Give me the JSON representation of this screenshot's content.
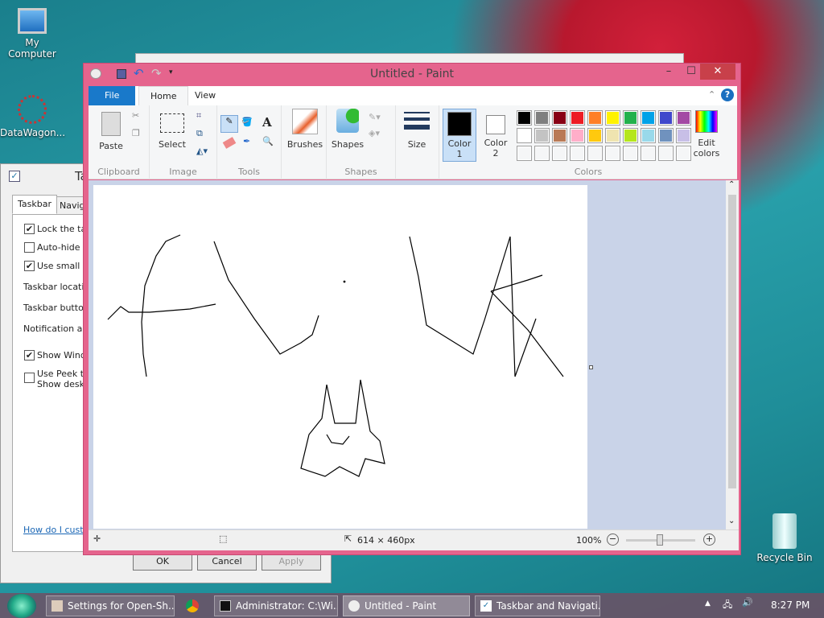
{
  "desktop": {
    "icons": [
      {
        "label": "My Computer",
        "icon": "computer-icon"
      },
      {
        "label": "DataWagon...",
        "icon": "shortcut-icon"
      },
      {
        "label": "Recycle Bin",
        "icon": "recycle-bin-icon"
      }
    ]
  },
  "dialog": {
    "title": "Ta",
    "tabs": [
      "Taskbar",
      "Naviga"
    ],
    "checks": [
      {
        "label": "Lock the tas",
        "checked": true
      },
      {
        "label": "Auto-hide th",
        "checked": false
      },
      {
        "label": "Use small ta",
        "checked": true
      }
    ],
    "labels": [
      "Taskbar locatio",
      "Taskbar button",
      "Notification are"
    ],
    "check2": [
      {
        "label": "Show Windo",
        "checked": true
      },
      {
        "label": "Use Peek to\nShow deskto",
        "checked": false
      }
    ],
    "help_link": "How do I custo",
    "buttons": {
      "ok": "OK",
      "cancel": "Cancel",
      "apply": "Apply"
    }
  },
  "paint": {
    "title": "Untitled - Paint",
    "tabs": {
      "file": "File",
      "home": "Home",
      "view": "View"
    },
    "groups": {
      "clipboard": "Clipboard",
      "image": "Image",
      "tools": "Tools",
      "shapes": "Shapes",
      "colors": "Colors"
    },
    "buttons": {
      "paste": "Paste",
      "select": "Select",
      "brushes": "Brushes",
      "shapes": "Shapes",
      "size": "Size",
      "color1": "Color\n1",
      "color2": "Color\n2",
      "edit_colors": "Edit\ncolors"
    },
    "palette": [
      [
        "#000000",
        "#7f7f7f",
        "#880015",
        "#ed1c24",
        "#ff7f27",
        "#fff200",
        "#22b14c",
        "#00a2e8",
        "#3f48cc",
        "#a349a4"
      ],
      [
        "#ffffff",
        "#c3c3c3",
        "#b97a57",
        "#ffaec9",
        "#ffc90e",
        "#efe4b0",
        "#b5e61d",
        "#99d9ea",
        "#7092be",
        "#c8bfe7"
      ]
    ],
    "color1": "#000000",
    "color2": "#ffffff",
    "accent": "#e5648d",
    "status": {
      "size": "614 × 460px",
      "zoom": "100%"
    }
  },
  "taskbar": {
    "items": [
      {
        "label": "Settings for Open-Sh..."
      },
      {
        "label": "Administrator: C:\\Wi..."
      },
      {
        "label": "Untitled - Paint"
      },
      {
        "label": "Taskbar and Navigati..."
      }
    ],
    "time": "8:27 PM"
  }
}
